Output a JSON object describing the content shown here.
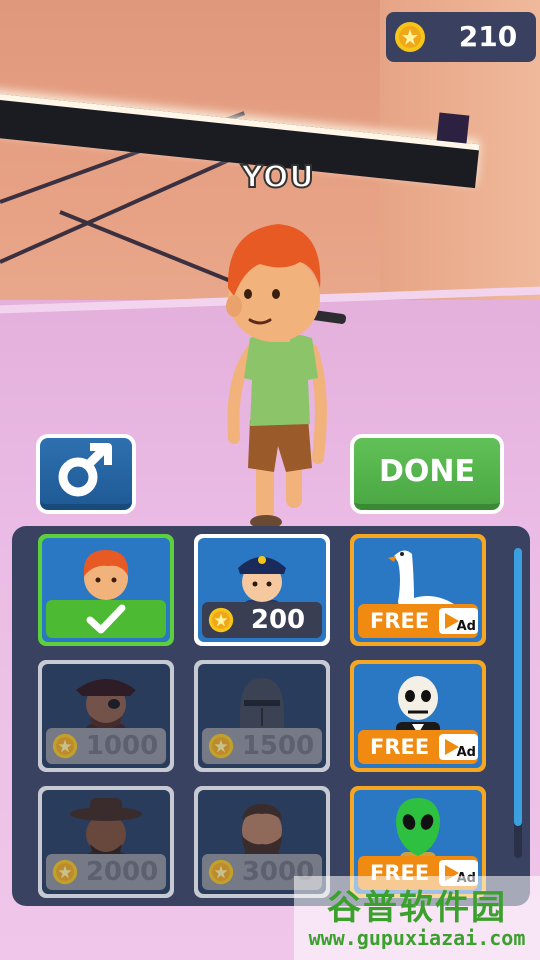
{
  "player_label": "YOU",
  "coins": {
    "amount": "210",
    "icon": "coin-icon"
  },
  "buttons": {
    "gender_icon": "male-symbol-icon",
    "done_label": "DONE"
  },
  "skins": [
    {
      "name": "red-hair-boy",
      "status": "selected",
      "icon": "checkmark-icon"
    },
    {
      "name": "police",
      "status": "price",
      "price": "200"
    },
    {
      "name": "goose",
      "status": "ad",
      "free_label": "FREE",
      "ad_label": "Ad"
    },
    {
      "name": "pirate",
      "status": "locked",
      "price": "1000"
    },
    {
      "name": "knight",
      "status": "locked",
      "price": "1500"
    },
    {
      "name": "skeleton",
      "status": "ad",
      "free_label": "FREE",
      "ad_label": "Ad"
    },
    {
      "name": "cowboy",
      "status": "locked",
      "price": "2000"
    },
    {
      "name": "bearded-man",
      "status": "locked",
      "price": "3000"
    },
    {
      "name": "alien",
      "status": "ad",
      "free_label": "FREE",
      "ad_label": "Ad"
    }
  ],
  "watermark": {
    "title": "谷普软件园",
    "url": "www.gupuxiazai.com"
  }
}
